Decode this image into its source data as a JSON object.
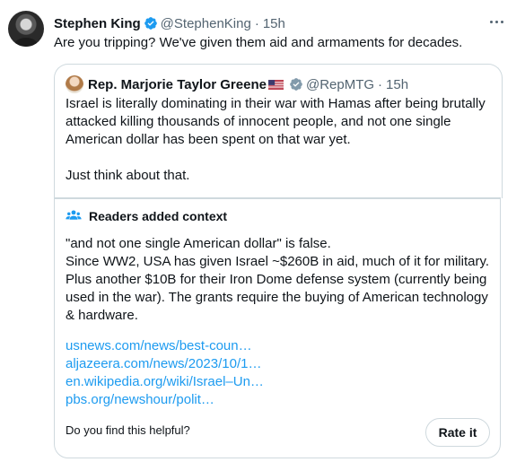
{
  "tweet": {
    "author_name": "Stephen King",
    "handle": "@StephenKing",
    "separator": "·",
    "time": "15h",
    "text": "Are you tripping? We've given them aid and armaments for decades.",
    "more_icon": "more-horizontal-icon",
    "verified_color": "#1d9bf0"
  },
  "quote": {
    "author_name": "Rep. Marjorie Taylor Greene",
    "handle": "@RepMTG",
    "separator": "·",
    "time": "15h",
    "flag_icon": "us-flag-icon",
    "verified_color": "#829aab",
    "lines": [
      "Israel is literally dominating in their war with Hamas after being brutally",
      "attacked killing thousands of innocent people, and not one single",
      "American dollar has been spent on that war yet."
    ],
    "closing": "Just think about that."
  },
  "community_note": {
    "title": "Readers added context",
    "icon": "people-icon",
    "lines": [
      "\"and not one single American dollar\" is false.",
      "Since WW2, USA has given Israel ~$260B in aid, much of it for military.",
      "Plus another $10B for their Iron Dome defense system (currently being",
      "used in the war). The grants require the buying of American technology",
      "& hardware."
    ],
    "links": [
      "usnews.com/news/best-coun…",
      "aljazeera.com/news/2023/10/1…",
      "en.wikipedia.org/wiki/Israel–Un…",
      "pbs.org/newshour/polit…"
    ],
    "helpful_prompt": "Do you find this helpful?",
    "rate_button": "Rate it",
    "link_color": "#1d9bf0"
  }
}
